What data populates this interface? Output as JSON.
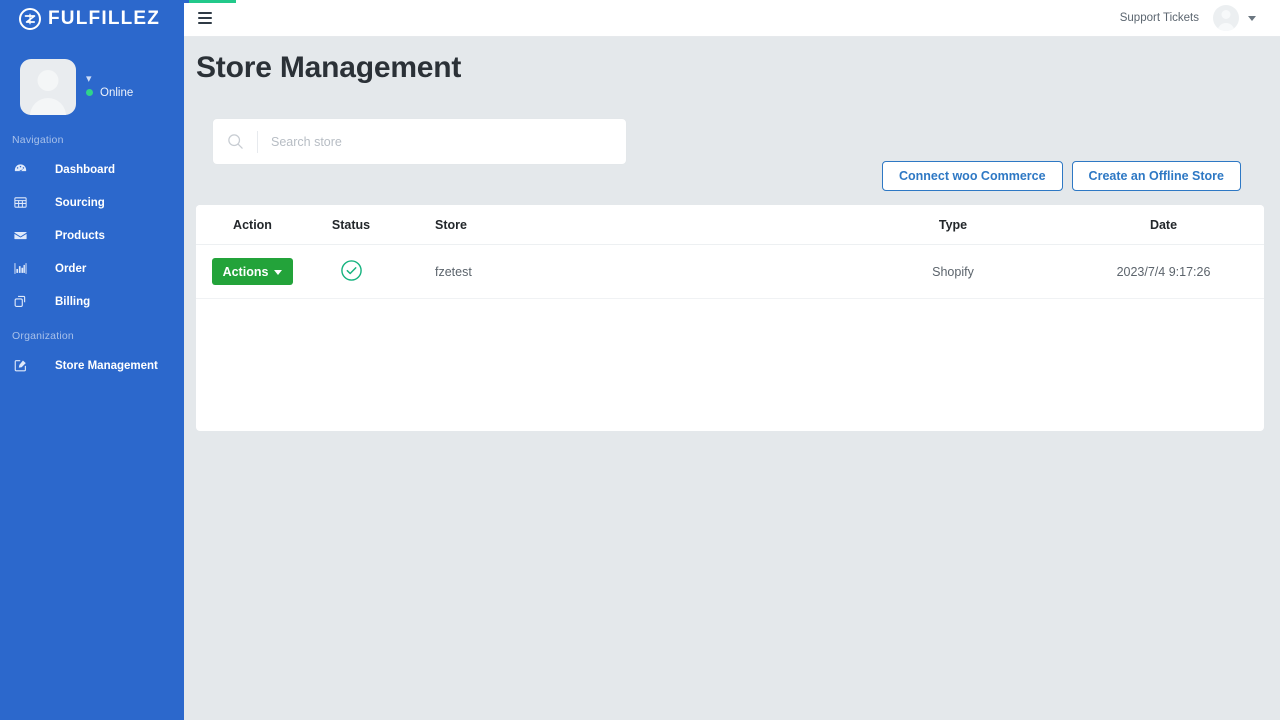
{
  "brand": {
    "name": "FULFILLEZ",
    "logo_icon": "circle-z-logo-icon"
  },
  "sidebar": {
    "profile": {
      "status_label": "Online",
      "status_color": "#2fd48a",
      "avatar_icon": "user-avatar-placeholder-icon",
      "caret_icon": "chevron-down-icon"
    },
    "sections": [
      {
        "title": "Navigation",
        "items": [
          {
            "label": "Dashboard",
            "icon": "speedometer-icon"
          },
          {
            "label": "Sourcing",
            "icon": "grid-table-icon"
          },
          {
            "label": "Products",
            "icon": "envelope-icon"
          },
          {
            "label": "Order",
            "icon": "bar-chart-icon"
          },
          {
            "label": "Billing",
            "icon": "copy-layers-icon"
          }
        ]
      },
      {
        "title": "Organization",
        "items": [
          {
            "label": "Store Management",
            "icon": "edit-square-icon"
          }
        ]
      }
    ]
  },
  "topbar": {
    "menu_icon": "hamburger-menu-icon",
    "support_link": "Support Tickets",
    "avatar_icon": "user-avatar-icon",
    "caret_icon": "caret-down-icon",
    "progress_color": "#22c98a"
  },
  "page": {
    "title": "Store Management"
  },
  "search": {
    "placeholder": "Search store",
    "value": "",
    "icon": "search-icon"
  },
  "actions": {
    "connect_woo_commerce": "Connect woo Commerce",
    "create_offline_store": "Create an Offline Store"
  },
  "table": {
    "columns": [
      "Action",
      "Status",
      "Store",
      "",
      "Type",
      "Date"
    ],
    "rows": [
      {
        "action_label": "Actions",
        "action_caret": "chevron-down-icon",
        "status_icon": "circle-check-icon",
        "store": "fzetest",
        "type": "Shopify",
        "date": "2023/7/4 9:17:26"
      }
    ]
  },
  "colors": {
    "sidebar_blue": "#2c68cc",
    "accent_blue": "#2e78c4",
    "action_green": "#23a33a",
    "status_green": "#16b37f",
    "page_background": "#e4e8eb"
  }
}
